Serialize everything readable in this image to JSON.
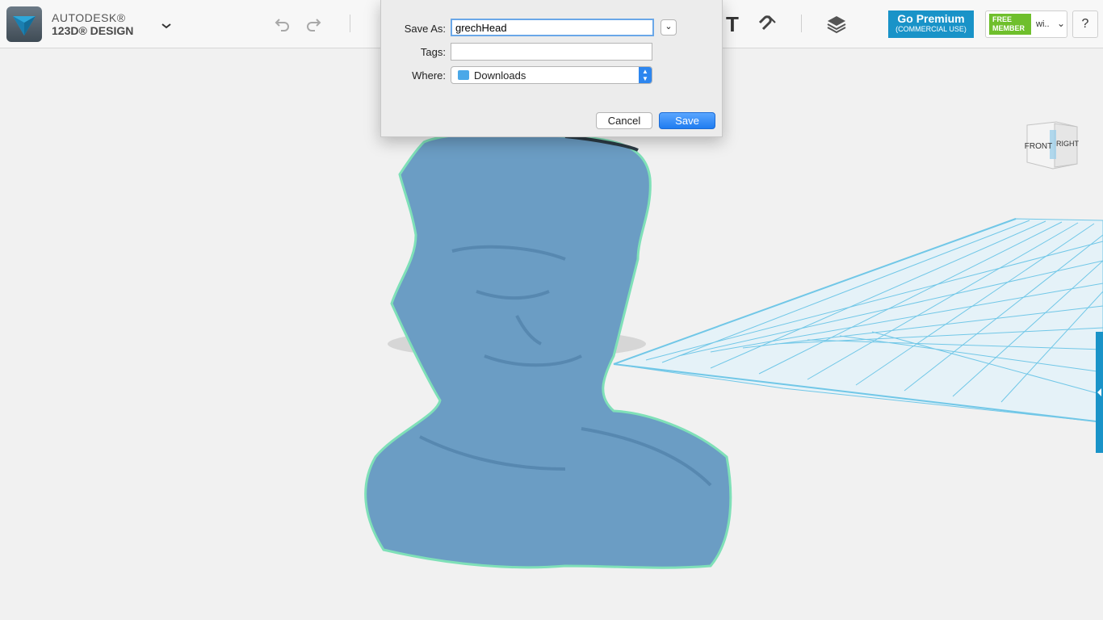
{
  "app": {
    "brand_line1": "AUTODESK®",
    "brand_line2": "123D® DESIGN"
  },
  "toolbar": {
    "menu_icon": "chevron-down-icon",
    "undo_icon": "undo-icon",
    "redo_icon": "redo-icon",
    "text_tool_label": "T",
    "snap_icon": "magnet-icon",
    "layers_icon": "layers-icon"
  },
  "premium": {
    "title": "Go Premium",
    "subtitle": "(COMMERCIAL USE)"
  },
  "member": {
    "badge_line1": "FREE",
    "badge_line2": "MEMBER",
    "username": "wi..",
    "chevron": "⌄"
  },
  "help": {
    "label": "?"
  },
  "view_cube": {
    "front": "FRONT",
    "right": "RIGHT"
  },
  "colors": {
    "accent": "#1993c8",
    "member_green": "#6fbf2c",
    "grid": "#5bc0e6",
    "mesh": "#6b9dc4",
    "mesh_outline": "#7fe0b8"
  },
  "dialog": {
    "save_as_label": "Save As:",
    "save_as_value": "grechHead",
    "tags_label": "Tags:",
    "tags_value": "",
    "where_label": "Where:",
    "where_value": "Downloads",
    "expand_glyph": "⌄",
    "cancel_label": "Cancel",
    "save_label": "Save"
  }
}
